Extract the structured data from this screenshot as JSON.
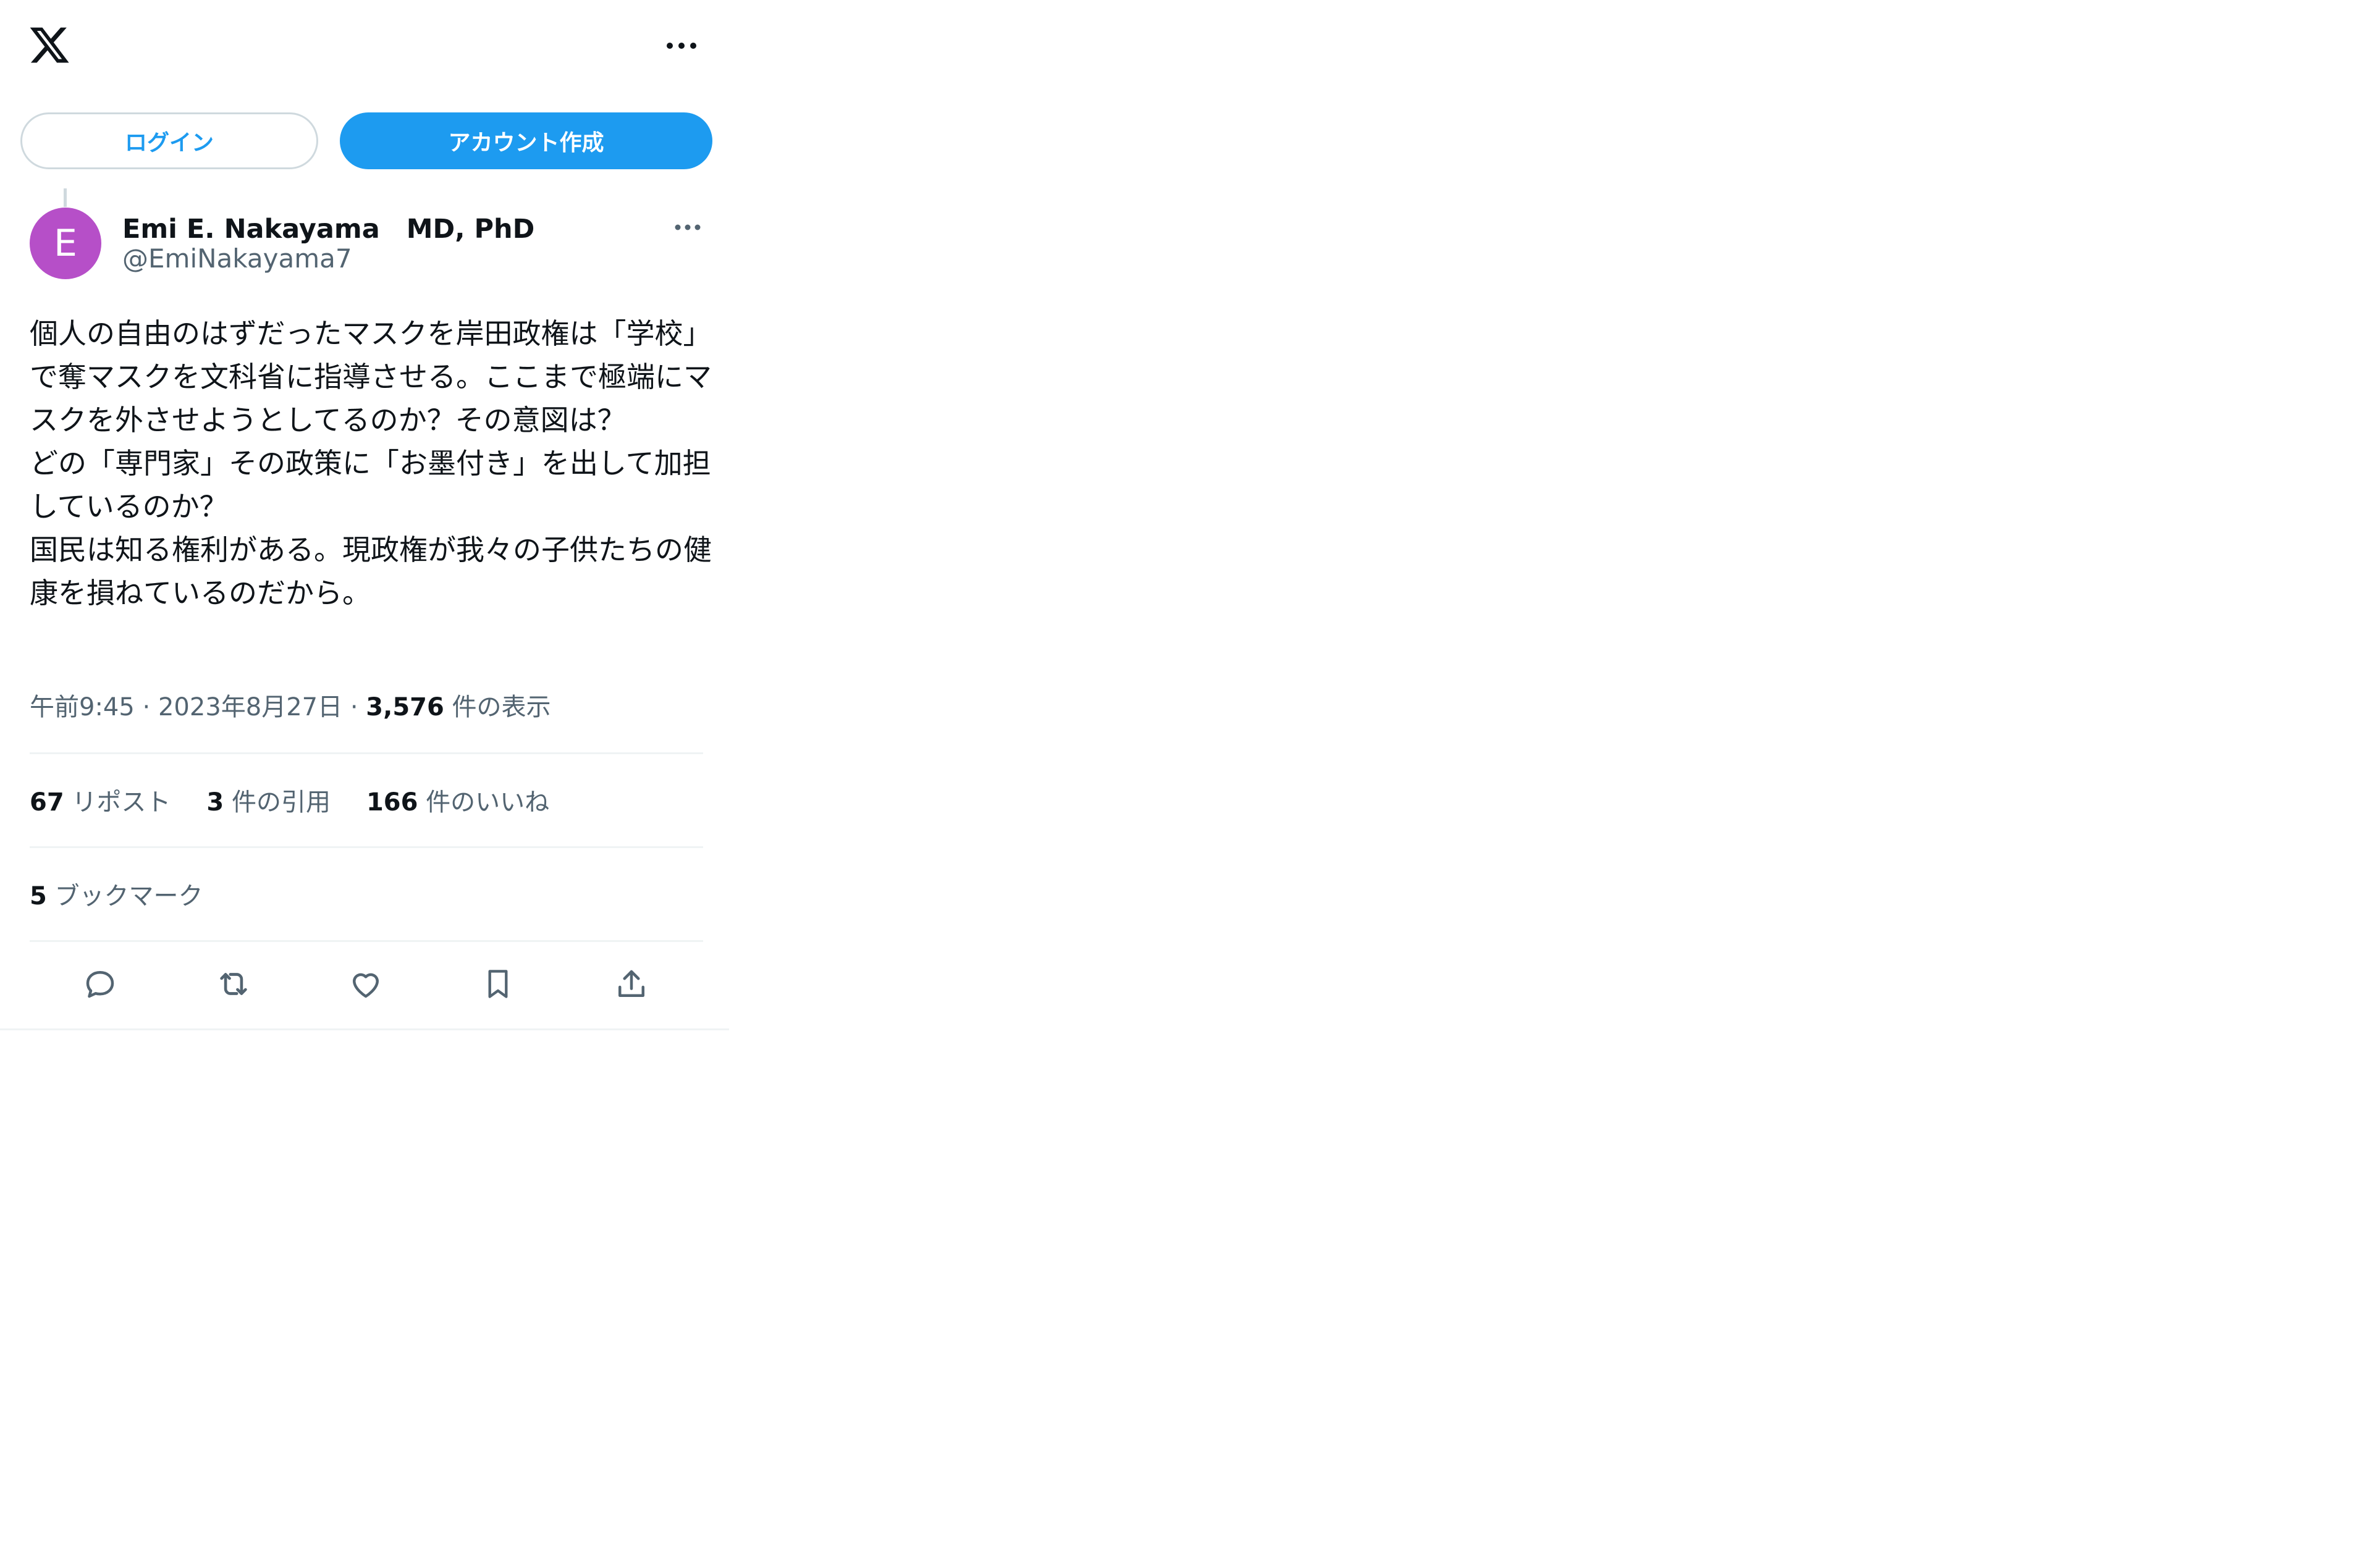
{
  "header": {
    "logo_icon": "x-logo-icon",
    "more_icon": "more-horizontal-icon"
  },
  "auth": {
    "login_label": "ログイン",
    "signup_label": "アカウント作成"
  },
  "colors": {
    "accent": "#1d9bf0",
    "avatar_bg": "#b64fc8",
    "secondary_text": "#536471",
    "divider": "#eff3f4"
  },
  "post": {
    "avatar_letter": "E",
    "display_name": "Emi E. Nakayama　MD, PhD",
    "handle": "@EmiNakayama7",
    "text": "個人の自由のはずだったマスクを岸田政権は「学校」で奪マスクを文科省に指導させる。ここまで極端にマスクを外させようとしてるのか？その意図は？\nどの「専門家」その政策に「お墨付き」を出して加担しているのか？\n国民は知る権利がある。現政権が我々の子供たちの健康を損ねているのだから。",
    "time": "午前9:45",
    "date": "2023年8月27日",
    "separator": "·",
    "views_count": "3,576",
    "views_label": "件の表示"
  },
  "stats": {
    "reposts_count": "67",
    "reposts_label": "リポスト",
    "quotes_count": "3",
    "quotes_label": "件の引用",
    "likes_count": "166",
    "likes_label": "件のいいね",
    "bookmarks_count": "5",
    "bookmarks_label": "ブックマーク"
  },
  "actions": [
    "reply-icon",
    "repost-icon",
    "like-icon",
    "bookmark-icon",
    "share-icon"
  ]
}
